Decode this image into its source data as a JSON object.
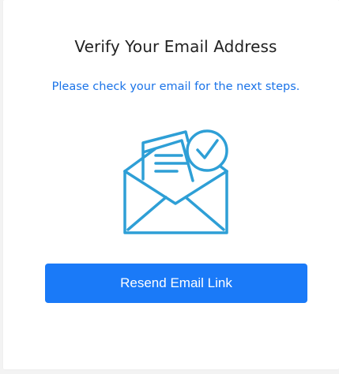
{
  "card": {
    "title": "Verify Your Email Address",
    "subtitle": "Please check your email for the next steps.",
    "illustration_icon": "email-verified-icon",
    "resend_button_label": "Resend Email Link"
  },
  "colors": {
    "title": "#222222",
    "accent_text": "#1a73e8",
    "button_bg": "#1a7af8",
    "button_text": "#ffffff",
    "icon_stroke": "#2e9fd6"
  }
}
